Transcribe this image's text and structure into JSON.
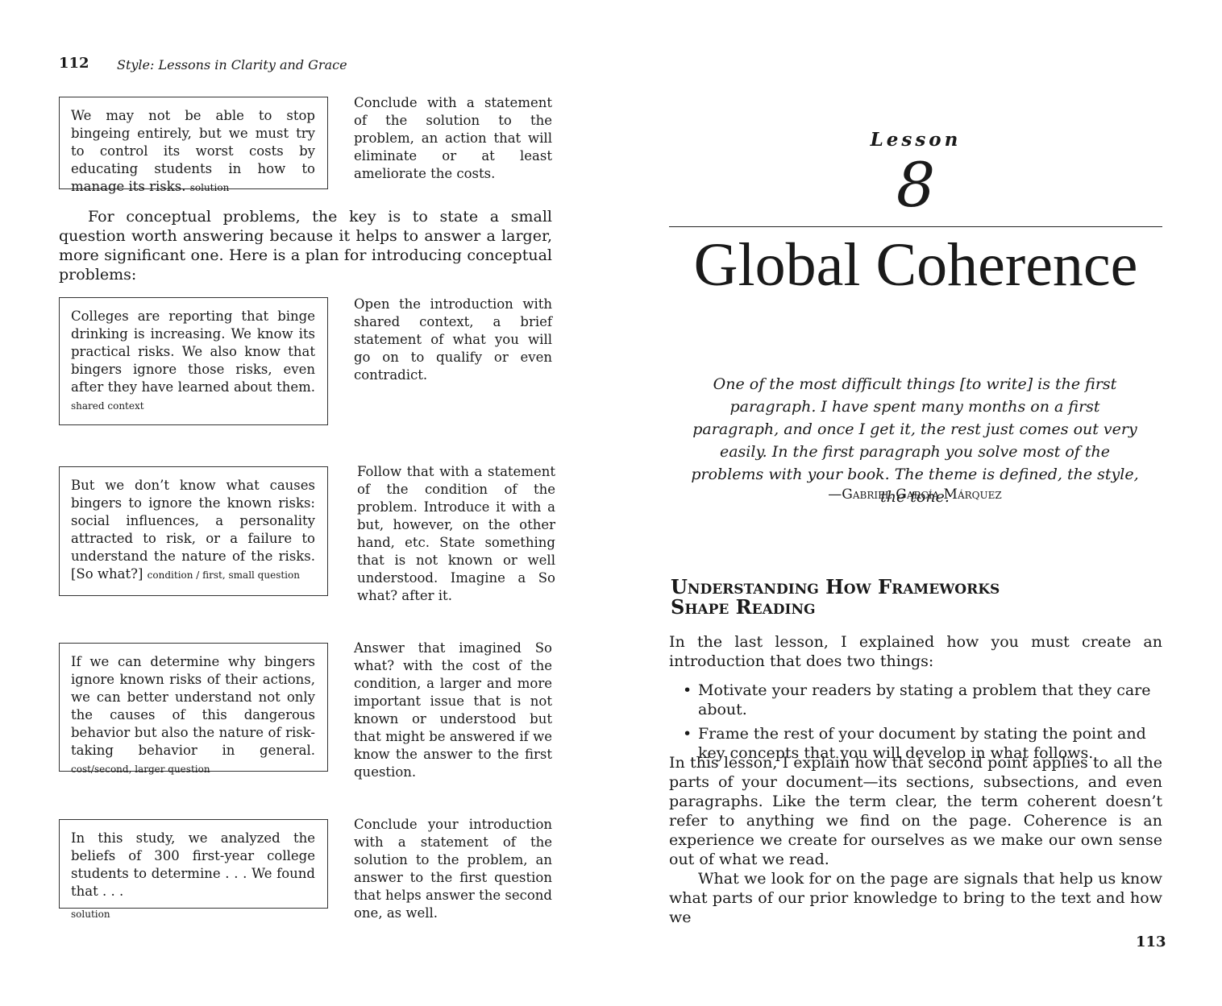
{
  "left_page": {
    "page_number": "112",
    "running_head": "Style: Lessons in Clarity and Grace",
    "blocks": [
      {
        "box_text": "We may not be able to stop bingeing entirely, but we must try to control its worst costs by educating students in how to manage its risks.",
        "box_tag": "solution",
        "note_text": "Conclude with a statement of the solution to the problem, an action that will eliminate or at least ameliorate the costs."
      },
      {
        "box_text": "Colleges are reporting that binge drinking is increasing. We know its practical risks. We also know that bingers ignore those risks, even after they have learned about them.",
        "box_tag": "shared context",
        "note_text": "Open the introduction with shared context, a brief statement of what you will go on to qualify or even contradict."
      },
      {
        "box_text": "But we don’t know what causes bingers to ignore the known risks: social influences, a personality attracted to risk, or a failure to understand the nature of the risks. [So what?]",
        "box_tag": "condition / first, small question",
        "note_text": "Follow that with a statement of the condition of the problem. Introduce it with a but, however, on the other hand, etc. State something that is not known or well understood. Imagine a So what? after it."
      },
      {
        "box_text": "If we can determine why bingers ignore known risks of their actions, we can better understand not only the causes of this dangerous behavior but also the nature of risk-taking behavior in general.",
        "box_tag": "cost/second, larger question",
        "note_text": "Answer that imagined So what? with the cost of the condition, a larger and more important issue that is not known or understood but that might be answered if we know the answer to the first question."
      },
      {
        "box_text": "In this study, we analyzed the beliefs of 300 first-year college students to determine . . . We found that . . .",
        "box_tag": "solution",
        "note_text": "Conclude your introduction with a statement of the solution to the problem, an answer to the first question that helps answer the second one, as well."
      }
    ],
    "paragraph": "For conceptual problems, the key is to state a small question worth answering because it helps to answer a larger, more significant one. Here is a plan for introducing conceptual problems:"
  },
  "right_page": {
    "lesson_label": "Lesson",
    "lesson_number": "8",
    "chapter_title": "Global Coherence",
    "epigraph": "One of the most difficult things [to write] is the first paragraph. I have spent many months on a first paragraph, and once I get it, the rest just comes out very easily. In the first paragraph you solve most of the problems with your book. The theme is defined, the style, the tone.",
    "attribution": "—Gabriel García Márquez",
    "section_heading_line1": "Understanding How Frameworks",
    "section_heading_line2": "Shape Reading",
    "para1": "In the last lesson, I explained how you must create an introduction that does two things:",
    "bullets": [
      "Motivate your readers by stating a problem that they care about.",
      "Frame the rest of your document by stating the point and key concepts that you will develop in what follows."
    ],
    "para2": "In this lesson, I explain how that second point applies to all the parts of your document—its sections, subsections, and even paragraphs. Like the term clear, the term coherent doesn’t refer to anything we find on the page. Coherence is an experience we create for ourselves as we make our own sense out of what we read.",
    "para3": "What we look for on the page are signals that help us know what parts of our prior knowledge to bring to the text and how we",
    "page_number": "113"
  }
}
